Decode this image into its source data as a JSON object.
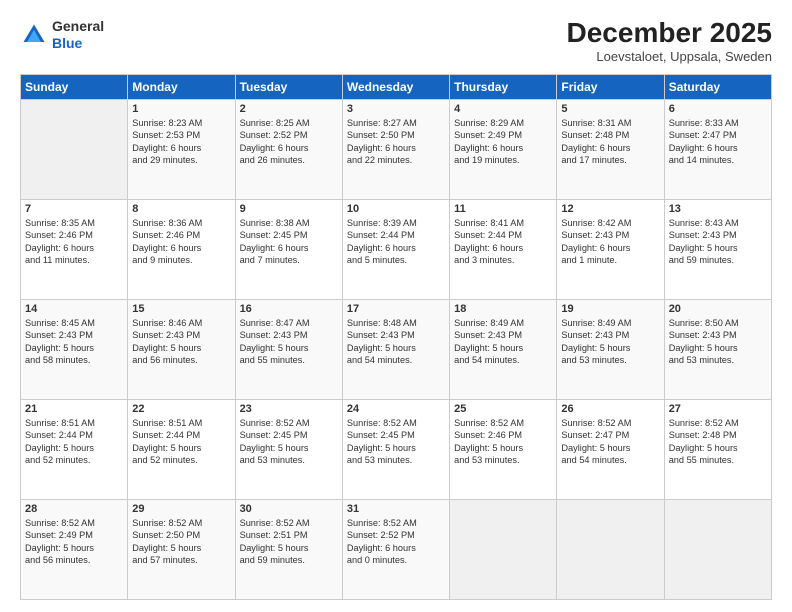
{
  "logo": {
    "line1": "General",
    "line2": "Blue"
  },
  "header": {
    "month": "December 2025",
    "location": "Loevstaloet, Uppsala, Sweden"
  },
  "days_of_week": [
    "Sunday",
    "Monday",
    "Tuesday",
    "Wednesday",
    "Thursday",
    "Friday",
    "Saturday"
  ],
  "weeks": [
    [
      {
        "day": "",
        "info": ""
      },
      {
        "day": "1",
        "info": "Sunrise: 8:23 AM\nSunset: 2:53 PM\nDaylight: 6 hours\nand 29 minutes."
      },
      {
        "day": "2",
        "info": "Sunrise: 8:25 AM\nSunset: 2:52 PM\nDaylight: 6 hours\nand 26 minutes."
      },
      {
        "day": "3",
        "info": "Sunrise: 8:27 AM\nSunset: 2:50 PM\nDaylight: 6 hours\nand 22 minutes."
      },
      {
        "day": "4",
        "info": "Sunrise: 8:29 AM\nSunset: 2:49 PM\nDaylight: 6 hours\nand 19 minutes."
      },
      {
        "day": "5",
        "info": "Sunrise: 8:31 AM\nSunset: 2:48 PM\nDaylight: 6 hours\nand 17 minutes."
      },
      {
        "day": "6",
        "info": "Sunrise: 8:33 AM\nSunset: 2:47 PM\nDaylight: 6 hours\nand 14 minutes."
      }
    ],
    [
      {
        "day": "7",
        "info": "Sunrise: 8:35 AM\nSunset: 2:46 PM\nDaylight: 6 hours\nand 11 minutes."
      },
      {
        "day": "8",
        "info": "Sunrise: 8:36 AM\nSunset: 2:46 PM\nDaylight: 6 hours\nand 9 minutes."
      },
      {
        "day": "9",
        "info": "Sunrise: 8:38 AM\nSunset: 2:45 PM\nDaylight: 6 hours\nand 7 minutes."
      },
      {
        "day": "10",
        "info": "Sunrise: 8:39 AM\nSunset: 2:44 PM\nDaylight: 6 hours\nand 5 minutes."
      },
      {
        "day": "11",
        "info": "Sunrise: 8:41 AM\nSunset: 2:44 PM\nDaylight: 6 hours\nand 3 minutes."
      },
      {
        "day": "12",
        "info": "Sunrise: 8:42 AM\nSunset: 2:43 PM\nDaylight: 6 hours\nand 1 minute."
      },
      {
        "day": "13",
        "info": "Sunrise: 8:43 AM\nSunset: 2:43 PM\nDaylight: 5 hours\nand 59 minutes."
      }
    ],
    [
      {
        "day": "14",
        "info": "Sunrise: 8:45 AM\nSunset: 2:43 PM\nDaylight: 5 hours\nand 58 minutes."
      },
      {
        "day": "15",
        "info": "Sunrise: 8:46 AM\nSunset: 2:43 PM\nDaylight: 5 hours\nand 56 minutes."
      },
      {
        "day": "16",
        "info": "Sunrise: 8:47 AM\nSunset: 2:43 PM\nDaylight: 5 hours\nand 55 minutes."
      },
      {
        "day": "17",
        "info": "Sunrise: 8:48 AM\nSunset: 2:43 PM\nDaylight: 5 hours\nand 54 minutes."
      },
      {
        "day": "18",
        "info": "Sunrise: 8:49 AM\nSunset: 2:43 PM\nDaylight: 5 hours\nand 54 minutes."
      },
      {
        "day": "19",
        "info": "Sunrise: 8:49 AM\nSunset: 2:43 PM\nDaylight: 5 hours\nand 53 minutes."
      },
      {
        "day": "20",
        "info": "Sunrise: 8:50 AM\nSunset: 2:43 PM\nDaylight: 5 hours\nand 53 minutes."
      }
    ],
    [
      {
        "day": "21",
        "info": "Sunrise: 8:51 AM\nSunset: 2:44 PM\nDaylight: 5 hours\nand 52 minutes."
      },
      {
        "day": "22",
        "info": "Sunrise: 8:51 AM\nSunset: 2:44 PM\nDaylight: 5 hours\nand 52 minutes."
      },
      {
        "day": "23",
        "info": "Sunrise: 8:52 AM\nSunset: 2:45 PM\nDaylight: 5 hours\nand 53 minutes."
      },
      {
        "day": "24",
        "info": "Sunrise: 8:52 AM\nSunset: 2:45 PM\nDaylight: 5 hours\nand 53 minutes."
      },
      {
        "day": "25",
        "info": "Sunrise: 8:52 AM\nSunset: 2:46 PM\nDaylight: 5 hours\nand 53 minutes."
      },
      {
        "day": "26",
        "info": "Sunrise: 8:52 AM\nSunset: 2:47 PM\nDaylight: 5 hours\nand 54 minutes."
      },
      {
        "day": "27",
        "info": "Sunrise: 8:52 AM\nSunset: 2:48 PM\nDaylight: 5 hours\nand 55 minutes."
      }
    ],
    [
      {
        "day": "28",
        "info": "Sunrise: 8:52 AM\nSunset: 2:49 PM\nDaylight: 5 hours\nand 56 minutes."
      },
      {
        "day": "29",
        "info": "Sunrise: 8:52 AM\nSunset: 2:50 PM\nDaylight: 5 hours\nand 57 minutes."
      },
      {
        "day": "30",
        "info": "Sunrise: 8:52 AM\nSunset: 2:51 PM\nDaylight: 5 hours\nand 59 minutes."
      },
      {
        "day": "31",
        "info": "Sunrise: 8:52 AM\nSunset: 2:52 PM\nDaylight: 6 hours\nand 0 minutes."
      },
      {
        "day": "",
        "info": ""
      },
      {
        "day": "",
        "info": ""
      },
      {
        "day": "",
        "info": ""
      }
    ]
  ]
}
